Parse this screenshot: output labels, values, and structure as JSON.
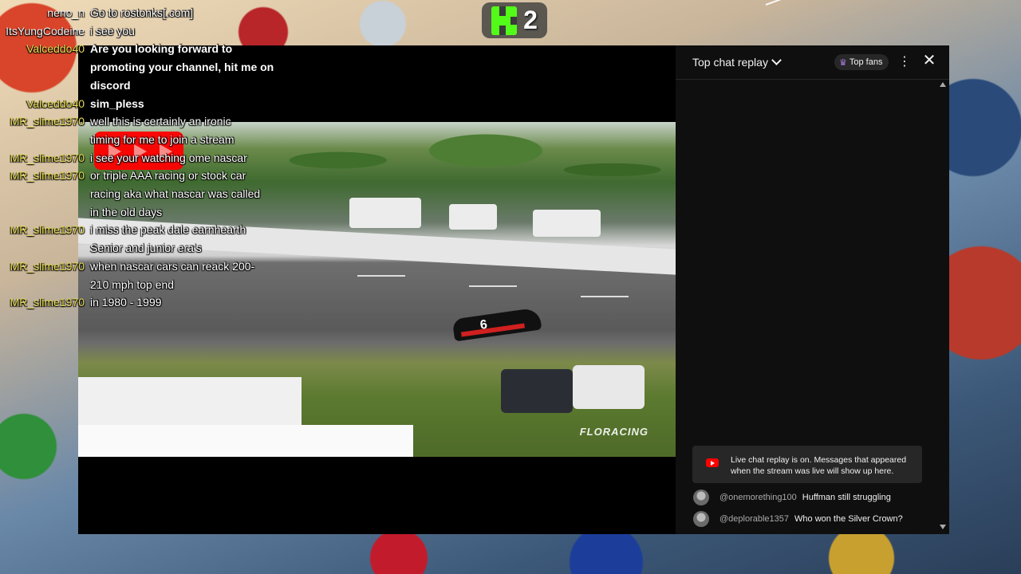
{
  "kick": {
    "count": "2"
  },
  "overlay_chat": [
    {
      "user": "neno_n",
      "lines": [
        "Go to rostonks[.com]"
      ]
    },
    {
      "user": "ItsYungCodeine",
      "lines": [
        "i see you"
      ]
    },
    {
      "user": "Valceddo40",
      "lines": [
        "Are you looking forward to",
        "promoting your channel, hit me on",
        "discord"
      ]
    },
    {
      "user": "Valceddo40",
      "lines": [
        "sim_pless"
      ]
    },
    {
      "user": "MR_slime1970",
      "lines": [
        "well this is certainly an ironic",
        "timing for me to join a stream"
      ]
    },
    {
      "user": "MR_slime1970",
      "lines": [
        "i see your watching ome nascar"
      ]
    },
    {
      "user": "MR_slime1970",
      "lines": [
        "or triple AAA racing or stock car",
        "racing aka what nascar was called",
        "in the old days"
      ]
    },
    {
      "user": "MR_slime1970",
      "lines": [
        "i miss the peak dale earnhearth",
        "Senior and junior era's"
      ]
    },
    {
      "user": "MR_slime1970",
      "lines": [
        "when nascar cars can reack 200-",
        "210 mph top end"
      ]
    },
    {
      "user": "MR_slime1970",
      "lines": [
        "in 1980 - 1999"
      ]
    }
  ],
  "video": {
    "watermark": "FLORACING",
    "car_number": "6"
  },
  "yt_chat": {
    "title": "Top chat replay",
    "top_fans_label": "Top fans",
    "notice": "Live chat replay is on. Messages that appeared when the stream was live will show up here.",
    "messages": [
      {
        "author": "@onemorething100",
        "text": "Huffman still struggling"
      },
      {
        "author": "@deplorable1357",
        "text": "Who won the Silver Crown?"
      }
    ]
  }
}
